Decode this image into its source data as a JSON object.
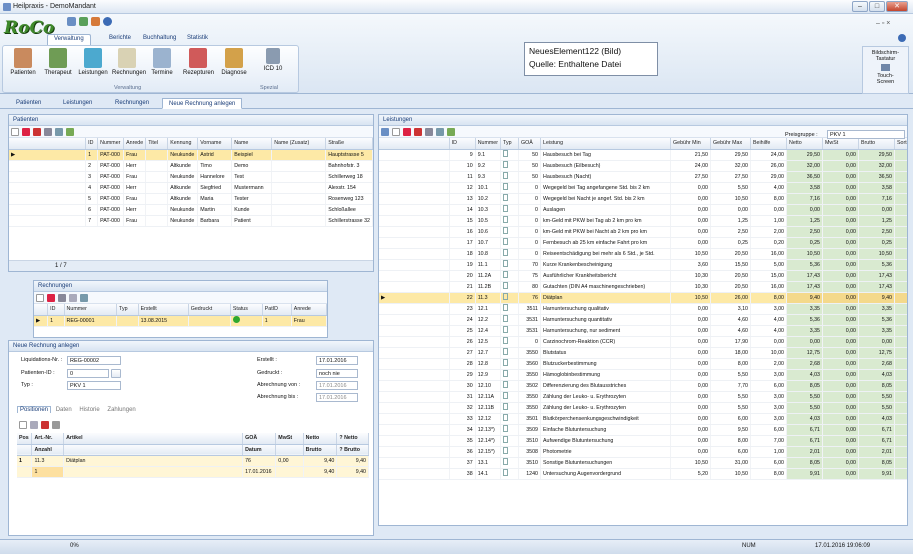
{
  "window": {
    "title": "Heilpraxis - DemoMandant"
  },
  "logo": {
    "text": "RoCo"
  },
  "ribbon": {
    "tabs": [
      "Verwaltung",
      "Berichte",
      "Buchhaltung",
      "Statistik"
    ],
    "buttons": [
      "Patienten",
      "Therapeut",
      "Leistungen",
      "Rechnungen",
      "Termine",
      "Rezepturen",
      "Diagnose"
    ],
    "icd_button": "ICD 10",
    "group_verwaltung": "Verwaltung",
    "group_spezial": "Spezial"
  },
  "tooltip": {
    "line1": "NeuesElement122  (Bild)",
    "line2": "Quelle: Enthaltene Datei"
  },
  "helpbox": {
    "l1": "Bildschirm-",
    "l2": "Tastatur",
    "l3": "Touch-",
    "l4": "Screen"
  },
  "doctabs": [
    "Patienten",
    "Leistungen",
    "Rechnungen",
    "Neue Rechnung anlegen"
  ],
  "patients": {
    "title": "Patienten",
    "columns": [
      "ID",
      "Nummer",
      "Anrede",
      "Titel",
      "Kennung",
      "Vorname",
      "Name",
      "Name (Zusatz)",
      "Straße"
    ],
    "rows": [
      [
        "1",
        "PAT-000",
        "Frau",
        "",
        "Neukunde",
        "Astrid",
        "Beispiel",
        "",
        "Hauptstrasse 5"
      ],
      [
        "2",
        "PAT-000",
        "Herr",
        "",
        "Altkunde",
        "Timo",
        "Demo",
        "",
        "Bahnhofstr. 3"
      ],
      [
        "3",
        "PAT-000",
        "Frau",
        "",
        "Neukunde",
        "Hannelore",
        "Test",
        "",
        "Schillerweg 18"
      ],
      [
        "4",
        "PAT-000",
        "Herr",
        "",
        "Altkunde",
        "Siegfried",
        "Mustermann",
        "",
        "Alexstr. 154"
      ],
      [
        "5",
        "PAT-000",
        "Frau",
        "",
        "Altkunde",
        "Maria",
        "Tester",
        "",
        "Rosenweg 123"
      ],
      [
        "6",
        "PAT-000",
        "Herr",
        "",
        "Neukunde",
        "Martin",
        "Kunde",
        "",
        "Schloßallee"
      ],
      [
        "7",
        "PAT-000",
        "Frau",
        "",
        "Neukunde",
        "Barbara",
        "Patient",
        "",
        "Schillerstrasse 32"
      ]
    ],
    "pager": "1 / 7"
  },
  "invoices": {
    "title": "Rechnungen",
    "columns": [
      "ID",
      "Nummer",
      "Typ",
      "Erstellt",
      "Gedruckt",
      "Status",
      "PatID",
      "Anrede"
    ],
    "rows": [
      [
        "1",
        "REG-00001",
        "",
        "13.08.2015",
        "",
        "",
        "1",
        "Frau"
      ]
    ]
  },
  "new_invoice": {
    "title": "Neue Rechnung anlegen",
    "liq_label": "Liquidations-Nr. :",
    "liq_value": "REG-00002",
    "pat_label": "Patienten-ID :",
    "pat_value": "0",
    "typ_label": "Typ :",
    "typ_value": "PKV 1",
    "erstellt_label": "Erstellt :",
    "erstellt_value": "17.01.2016",
    "gedruckt_label": "Gedruckt :",
    "gedruckt_value": "noch nie",
    "von_label": "Abrechnung von :",
    "von_value": "17.01.2016",
    "bis_label": "Abrechnung bis :",
    "bis_value": "17.01.2016",
    "tabs": [
      "Positionen",
      "Daten",
      "Historie",
      "Zahlungen"
    ],
    "columns1": [
      "Pos",
      "Art.-Nr.",
      "Artikel",
      "GOÄ",
      "MwSt",
      "Netto",
      "? Netto"
    ],
    "columns2": [
      "Anzahl",
      "Datum",
      "Brutto",
      "? Brutto"
    ],
    "row1": [
      "1",
      "11.3",
      "Diätplan",
      "76",
      "0,00",
      "9,40",
      "9,40"
    ],
    "row2": [
      "1",
      "17.01.2016",
      "9,40",
      "9,40"
    ]
  },
  "services": {
    "title": "Leistungen",
    "preis_label": "Preisgruppe :",
    "preis_value": "PKV 1",
    "columns": [
      "ID",
      "Nummer",
      "Typ",
      "GOÄ",
      "Leistung",
      "Gebühr Min",
      "Gebühr Max",
      "Beihilfe",
      "Netto",
      "MwSt",
      "Brutto",
      "Sorter"
    ],
    "rows": [
      [
        "9",
        "9.1",
        "50",
        "Hausbesuch bei Tag",
        "21,50",
        "29,50",
        "24,00",
        "29,50",
        "0,00",
        "29,50",
        "100"
      ],
      [
        "10",
        "9.2",
        "50",
        "Hausbesuch (Eilbesuch)",
        "24,00",
        "32,00",
        "26,00",
        "32,00",
        "0,00",
        "32,00",
        "100"
      ],
      [
        "11",
        "9.3",
        "50",
        "Hausbesuch (Nacht)",
        "27,50",
        "27,50",
        "29,00",
        "36,50",
        "0,00",
        "36,50",
        "100"
      ],
      [
        "12",
        "10.1",
        "0",
        "Wegegeld bei Tag angefangene Std. bis 2 km",
        "0,00",
        "5,50",
        "4,00",
        "3,58",
        "0,00",
        "3,58",
        "100"
      ],
      [
        "13",
        "10.2",
        "0",
        "Wegegeld bei Nacht je angef. Std. bis 2 km",
        "0,00",
        "10,50",
        "8,00",
        "7,16",
        "0,00",
        "7,16",
        "100"
      ],
      [
        "14",
        "10.3",
        "0",
        "Auslagen",
        "0,00",
        "0,00",
        "0,00",
        "0,00",
        "0,00",
        "0,00",
        "100"
      ],
      [
        "15",
        "10.5",
        "0",
        "km-Geld mit PKW bei Tag ab 2 km pro km",
        "0,00",
        "1,25",
        "1,00",
        "1,25",
        "0,00",
        "1,25",
        "100"
      ],
      [
        "16",
        "10.6",
        "0",
        "km-Geld mit PKW bei Nacht ab 2 km pro km",
        "0,00",
        "2,50",
        "2,00",
        "2,50",
        "0,00",
        "2,50",
        "100"
      ],
      [
        "17",
        "10.7",
        "0",
        "Fernbesuch ab 25 km einfache Fahrt pro km",
        "0,00",
        "0,25",
        "0,20",
        "0,25",
        "0,00",
        "0,25",
        "100"
      ],
      [
        "18",
        "10.8",
        "0",
        "Reiseentschädigung bei mehr als 6 Std., je Std.",
        "10,50",
        "20,50",
        "16,00",
        "10,50",
        "0,00",
        "10,50",
        "100"
      ],
      [
        "19",
        "11.1",
        "70",
        "Kurze Krankenbescheinigung",
        "3,60",
        "15,50",
        "5,00",
        "5,36",
        "0,00",
        "5,36",
        "110"
      ],
      [
        "20",
        "11.2A",
        "75",
        "Ausführlicher Krankheitsbericht",
        "10,30",
        "20,50",
        "15,00",
        "17,43",
        "0,00",
        "17,43",
        "110"
      ],
      [
        "21",
        "11.2B",
        "80",
        "Gutachten (DIN A4 maschinengeschrieben)",
        "10,30",
        "20,50",
        "16,00",
        "17,43",
        "0,00",
        "17,43",
        "110"
      ],
      [
        "22",
        "11.3",
        "76",
        "Diätplan",
        "10,50",
        "26,00",
        "8,00",
        "9,40",
        "0,00",
        "9,40",
        "110"
      ],
      [
        "23",
        "12.1",
        "3511",
        "Harnuntersuchung qualitativ",
        "0,00",
        "3,10",
        "3,00",
        "3,35",
        "0,00",
        "3,35",
        "120"
      ],
      [
        "24",
        "12.2",
        "3531",
        "Harnuntersuchung quantitativ",
        "0,00",
        "4,60",
        "4,00",
        "5,36",
        "0,00",
        "5,36",
        "120"
      ],
      [
        "25",
        "12.4",
        "3531",
        "Harnuntersuchung, nur sediment",
        "0,00",
        "4,60",
        "4,00",
        "3,35",
        "0,00",
        "3,35",
        "120"
      ],
      [
        "26",
        "12.5",
        "0",
        "Carzinochrom-Reaktion (CCR)",
        "0,00",
        "17,90",
        "0,00",
        "0,00",
        "0,00",
        "0,00",
        "120"
      ],
      [
        "27",
        "12.7",
        "3550",
        "Blutstatus",
        "0,00",
        "18,00",
        "10,00",
        "12,75",
        "0,00",
        "12,75",
        "120"
      ],
      [
        "28",
        "12.8",
        "3560",
        "Blutzuckerbestimmung",
        "0,00",
        "8,00",
        "2,00",
        "2,68",
        "0,00",
        "2,68",
        "120"
      ],
      [
        "29",
        "12.9",
        "3550",
        "Hämoglobinbestimmung",
        "0,00",
        "5,50",
        "3,00",
        "4,03",
        "0,00",
        "4,03",
        "120"
      ],
      [
        "30",
        "12.10",
        "3502",
        "Differenzierung des Blutausstriches",
        "0,00",
        "7,70",
        "6,00",
        "8,05",
        "0,00",
        "8,05",
        "120"
      ],
      [
        "31",
        "12.11A",
        "3550",
        "Zählung der Leuko- u. Erythrozyten",
        "0,00",
        "5,50",
        "3,00",
        "5,50",
        "0,00",
        "5,50",
        "120"
      ],
      [
        "32",
        "12.11B",
        "3550",
        "Zählung der Leuko- u. Erythrozyten",
        "0,00",
        "5,50",
        "3,00",
        "5,50",
        "0,00",
        "5,50",
        "120"
      ],
      [
        "33",
        "12.12",
        "3501",
        "Blutkörperchensenkungsgeschwindigkeit",
        "0,00",
        "6,00",
        "3,00",
        "4,03",
        "0,00",
        "4,03",
        "120"
      ],
      [
        "34",
        "12.13*)",
        "3509",
        "Einfache Blutuntersuchung",
        "0,00",
        "9,50",
        "6,00",
        "6,71",
        "0,00",
        "6,71",
        "120"
      ],
      [
        "35",
        "12.14*)",
        "3510",
        "Aufwendige Blutuntersuchung",
        "0,00",
        "8,00",
        "7,00",
        "6,71",
        "0,00",
        "6,71",
        "120"
      ],
      [
        "36",
        "12.15*)",
        "3508",
        "Photometrie",
        "0,00",
        "6,00",
        "1,00",
        "2,01",
        "0,00",
        "2,01",
        "120"
      ],
      [
        "37",
        "13.1",
        "3510",
        "Sonstige Blutuntersuchungen",
        "10,50",
        "31,00",
        "6,00",
        "8,05",
        "0,00",
        "8,05",
        "130"
      ],
      [
        "38",
        "14.1",
        "1240",
        "Untersuchung Augenvordergrund",
        "5,20",
        "10,50",
        "8,00",
        "9,91",
        "0,00",
        "9,91",
        "140"
      ]
    ],
    "selected_index": 13
  },
  "statusbar": {
    "progress": "0%",
    "num": "NUM",
    "datetime": "17.01.2016 19:06:09"
  }
}
